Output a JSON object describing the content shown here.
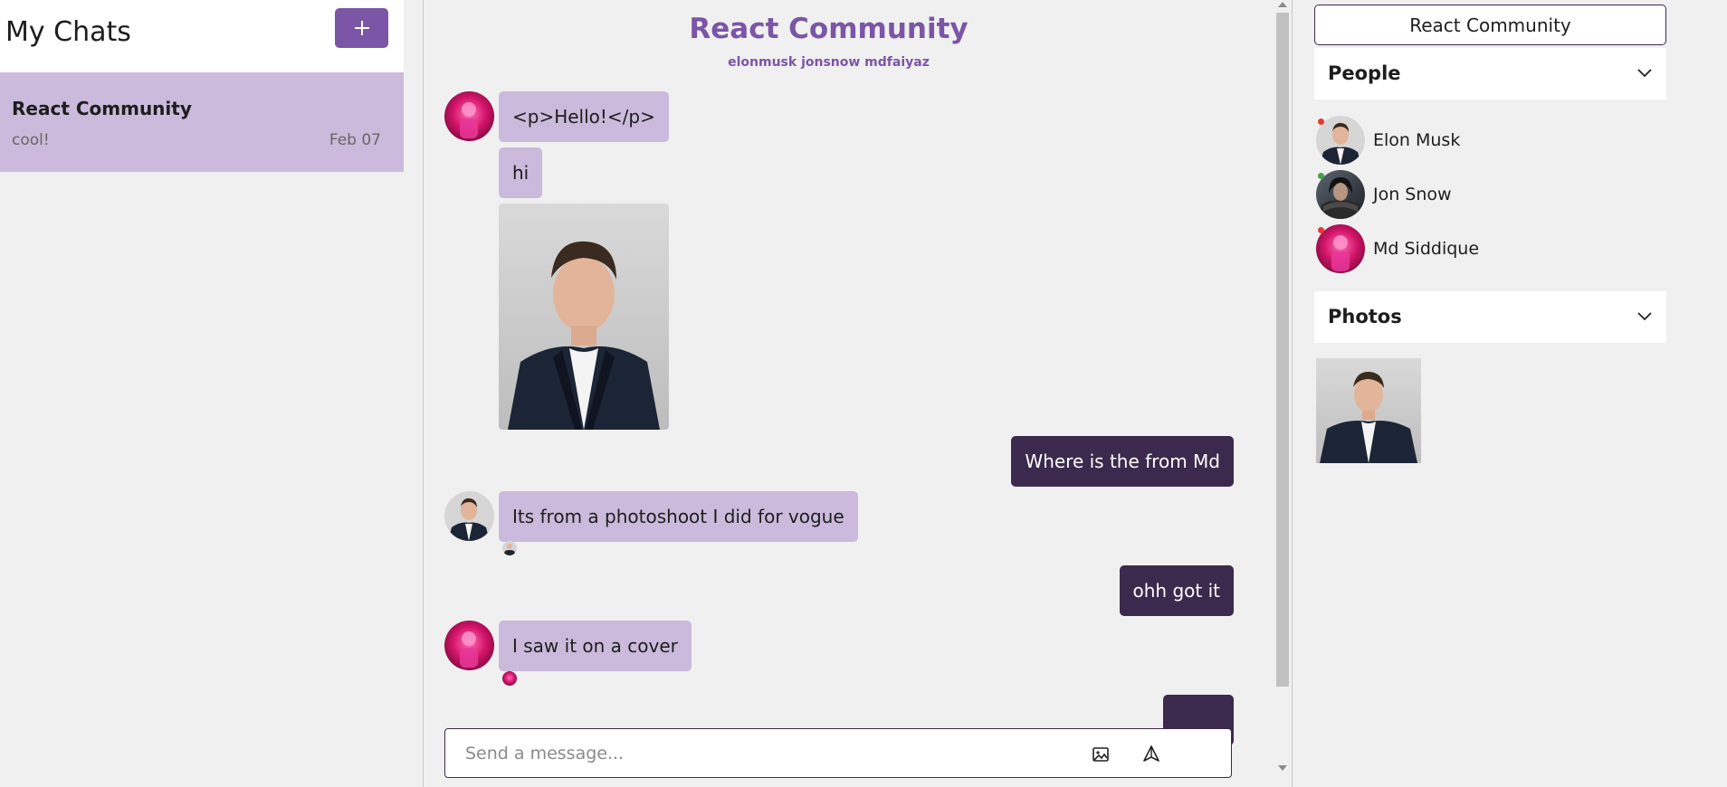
{
  "sidebar": {
    "title": "My Chats",
    "add_button_icon": "plus-icon",
    "chats": [
      {
        "name": "React Community",
        "last_message": "cool!",
        "date": "Feb 07"
      }
    ]
  },
  "chat": {
    "title": "React Community",
    "members": "elonmusk jonsnow mdfaiyaz",
    "messages": [
      {
        "direction": "in",
        "text": "<p>Hello!</p>"
      },
      {
        "direction": "in",
        "text": "hi"
      },
      {
        "direction": "in",
        "type": "image",
        "alt": "Elon Musk portrait"
      },
      {
        "direction": "out",
        "text": "Where is the from Md"
      },
      {
        "direction": "in",
        "text": "Its from a photoshoot I did for vogue"
      },
      {
        "direction": "out",
        "text": "ohh got it"
      },
      {
        "direction": "in",
        "text": "I saw it on a cover"
      },
      {
        "direction": "out",
        "text": ""
      }
    ],
    "input_placeholder": "Send a message..."
  },
  "details": {
    "title_button": "React Community",
    "people_label": "People",
    "people": [
      {
        "name": "Elon Musk",
        "status": "offline",
        "status_color": "#e53935"
      },
      {
        "name": "Jon Snow",
        "status": "online",
        "status_color": "#43a047"
      },
      {
        "name": "Md Siddique",
        "status": "offline",
        "status_color": "#e53935"
      }
    ],
    "photos_label": "Photos"
  },
  "colors": {
    "accent": "#7b55a6",
    "incoming_bubble": "#cbbadc",
    "outgoing_bubble": "#3b2a4d",
    "background": "#f0f0f0"
  }
}
